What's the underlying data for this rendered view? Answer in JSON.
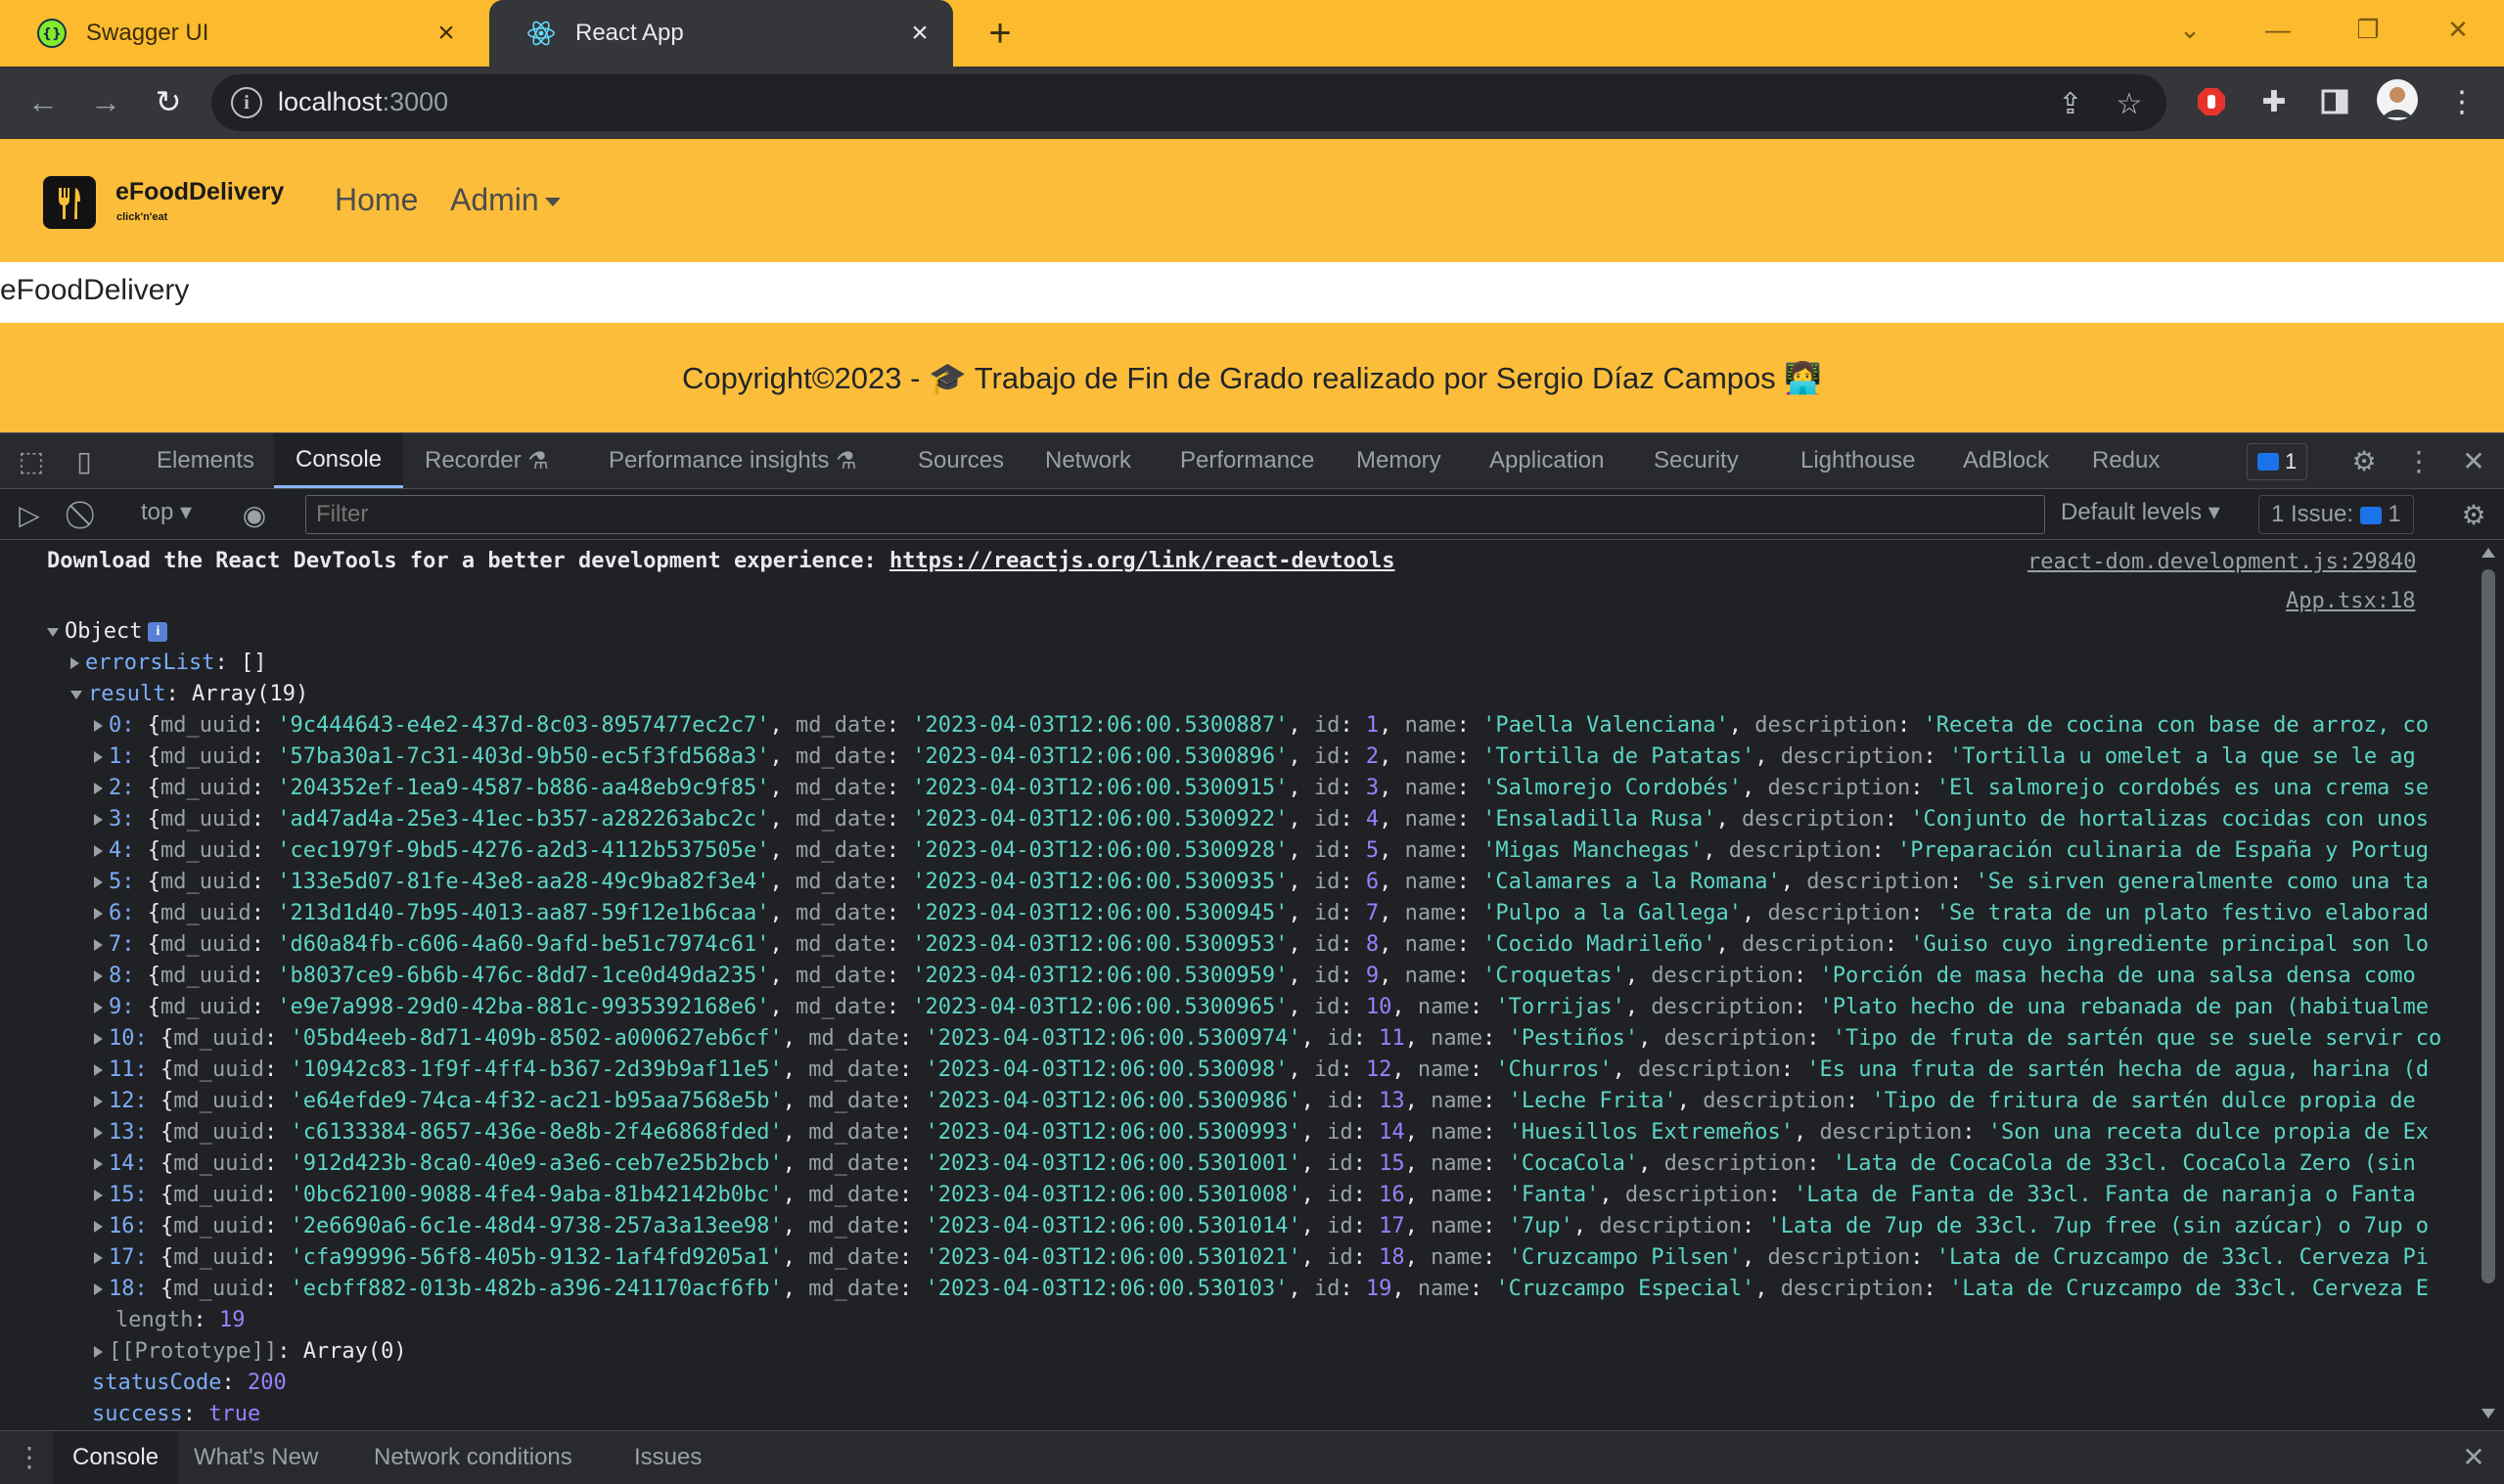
{
  "browser": {
    "tabs": [
      {
        "title": "Swagger UI",
        "icon": "swagger-icon"
      },
      {
        "title": "React App",
        "icon": "react-icon"
      }
    ],
    "new_tab": "+",
    "address": {
      "host": "localhost",
      "port": ":3000"
    },
    "profile_icon": "avatar"
  },
  "app": {
    "brand": "eFoodDelivery",
    "brand_tagline": "click'n'eat",
    "nav": {
      "home": "Home",
      "admin": "Admin"
    },
    "body_text": "eFoodDelivery",
    "footer": "Copyright©2023 - 🎓 Trabajo de Fin de Grado realizado por Sergio Díaz Campos 👩‍💻"
  },
  "devtools": {
    "tabs": [
      "Elements",
      "Console",
      "Recorder",
      "Performance insights",
      "Sources",
      "Network",
      "Performance",
      "Memory",
      "Application",
      "Security",
      "Lighthouse",
      "AdBlock",
      "Redux"
    ],
    "selected_tab": "Console",
    "issues_badge": "1",
    "context": "top",
    "filter_placeholder": "Filter",
    "levels": "Default levels",
    "issues_label": "1 Issue:",
    "issues_count": "1",
    "drawer_tabs": [
      "Console",
      "What's New",
      "Network conditions",
      "Issues"
    ]
  },
  "console": {
    "devtools_msg": "Download the React DevTools for a better development experience: ",
    "devtools_link": "https://reactjs.org/link/react-devtools",
    "devtools_src": "react-dom.development.js:29840",
    "app_src": "App.tsx:18",
    "object_label": "Object",
    "errors_label": "errorsList",
    "errors_value": "[]",
    "result_label": "result",
    "result_type": "Array(19)",
    "rows": [
      {
        "idx": "0",
        "uuid": "'9c444643-e4e2-437d-8c03-8957477ec2c7'",
        "date": "'2023-04-03T12:06:00.5300887'",
        "id": "1",
        "name": "'Paella Valenciana'",
        "desc": "'Receta de cocina con base de arroz, co"
      },
      {
        "idx": "1",
        "uuid": "'57ba30a1-7c31-403d-9b50-ec5f3fd568a3'",
        "date": "'2023-04-03T12:06:00.5300896'",
        "id": "2",
        "name": "'Tortilla de Patatas'",
        "desc": "'Tortilla u omelet  a la que se le ag"
      },
      {
        "idx": "2",
        "uuid": "'204352ef-1ea9-4587-b886-aa48eb9c9f85'",
        "date": "'2023-04-03T12:06:00.5300915'",
        "id": "3",
        "name": "'Salmorejo Cordobés'",
        "desc": "'El salmorejo cordobés es una crema se"
      },
      {
        "idx": "3",
        "uuid": "'ad47ad4a-25e3-41ec-b357-a282263abc2c'",
        "date": "'2023-04-03T12:06:00.5300922'",
        "id": "4",
        "name": "'Ensaladilla Rusa'",
        "desc": "'Conjunto de hortalizas cocidas con unos"
      },
      {
        "idx": "4",
        "uuid": "'cec1979f-9bd5-4276-a2d3-4112b537505e'",
        "date": "'2023-04-03T12:06:00.5300928'",
        "id": "5",
        "name": "'Migas Manchegas'",
        "desc": "'Preparación culinaria de España y Portug"
      },
      {
        "idx": "5",
        "uuid": "'133e5d07-81fe-43e8-aa28-49c9ba82f3e4'",
        "date": "'2023-04-03T12:06:00.5300935'",
        "id": "6",
        "name": "'Calamares a la Romana'",
        "desc": "'Se sirven generalmente como una ta"
      },
      {
        "idx": "6",
        "uuid": "'213d1d40-7b95-4013-aa87-59f12e1b6caa'",
        "date": "'2023-04-03T12:06:00.5300945'",
        "id": "7",
        "name": "'Pulpo a la Gallega'",
        "desc": "'Se trata de un plato festivo elaborad"
      },
      {
        "idx": "7",
        "uuid": "'d60a84fb-c606-4a60-9afd-be51c7974c61'",
        "date": "'2023-04-03T12:06:00.5300953'",
        "id": "8",
        "name": "'Cocido Madrileño'",
        "desc": "'Guiso cuyo ingrediente principal son lo"
      },
      {
        "idx": "8",
        "uuid": "'b8037ce9-6b6b-476c-8dd7-1ce0d49da235'",
        "date": "'2023-04-03T12:06:00.5300959'",
        "id": "9",
        "name": "'Croquetas'",
        "desc": "'Porción de masa hecha de una salsa densa como"
      },
      {
        "idx": "9",
        "uuid": "'e9e7a998-29d0-42ba-881c-9935392168e6'",
        "date": "'2023-04-03T12:06:00.5300965'",
        "id": "10",
        "name": "'Torrijas'",
        "desc": "'Plato hecho de una rebanada de pan (habitualme"
      },
      {
        "idx": "10",
        "uuid": "'05bd4eeb-8d71-409b-8502-a000627eb6cf'",
        "date": "'2023-04-03T12:06:00.5300974'",
        "id": "11",
        "name": "'Pestiños'",
        "desc": "'Tipo de fruta de sartén que se suele servir co"
      },
      {
        "idx": "11",
        "uuid": "'10942c83-1f9f-4ff4-b367-2d39b9af11e5'",
        "date": "'2023-04-03T12:06:00.530098'",
        "id": "12",
        "name": "'Churros'",
        "desc": "'Es una fruta de sartén hecha de agua, harina (d"
      },
      {
        "idx": "12",
        "uuid": "'e64efde9-74ca-4f32-ac21-b95aa7568e5b'",
        "date": "'2023-04-03T12:06:00.5300986'",
        "id": "13",
        "name": "'Leche Frita'",
        "desc": "'Tipo de fritura de sartén dulce propia de"
      },
      {
        "idx": "13",
        "uuid": "'c6133384-8657-436e-8e8b-2f4e6868fded'",
        "date": "'2023-04-03T12:06:00.5300993'",
        "id": "14",
        "name": "'Huesillos Extremeños'",
        "desc": "'Son una receta dulce propia de Ex"
      },
      {
        "idx": "14",
        "uuid": "'912d423b-8ca0-40e9-a3e6-ceb7e25b2bcb'",
        "date": "'2023-04-03T12:06:00.5301001'",
        "id": "15",
        "name": "'CocaCola'",
        "desc": "'Lata de CocaCola de 33cl. CocaCola Zero (sin"
      },
      {
        "idx": "15",
        "uuid": "'0bc62100-9088-4fe4-9aba-81b42142b0bc'",
        "date": "'2023-04-03T12:06:00.5301008'",
        "id": "16",
        "name": "'Fanta'",
        "desc": "'Lata de Fanta de 33cl. Fanta de naranja o Fanta"
      },
      {
        "idx": "16",
        "uuid": "'2e6690a6-6c1e-48d4-9738-257a3a13ee98'",
        "date": "'2023-04-03T12:06:00.5301014'",
        "id": "17",
        "name": "'7up'",
        "desc": "'Lata de 7up de 33cl. 7up free (sin azúcar) o 7up o"
      },
      {
        "idx": "17",
        "uuid": "'cfa99996-56f8-405b-9132-1af4fd9205a1'",
        "date": "'2023-04-03T12:06:00.5301021'",
        "id": "18",
        "name": "'Cruzcampo Pilsen'",
        "desc": "'Lata de Cruzcampo de 33cl. Cerveza Pi"
      },
      {
        "idx": "18",
        "uuid": "'ecbff882-013b-482b-a396-241170acf6fb'",
        "date": "'2023-04-03T12:06:00.530103'",
        "id": "19",
        "name": "'Cruzcampo Especial'",
        "desc": "'Lata de Cruzcampo de 33cl. Cerveza E"
      }
    ],
    "length_label": "length",
    "length_value": "19",
    "proto_label": "[[Prototype]]",
    "proto_value": "Array(0)",
    "status_label": "statusCode",
    "status_value": "200",
    "success_label": "success",
    "success_value": "true"
  },
  "colors": {
    "brand_yellow": "#fcbe3a",
    "devtools_bg": "#202124",
    "string": "#5cd5c7",
    "number": "#9980ff",
    "key": "#7cacf8"
  }
}
